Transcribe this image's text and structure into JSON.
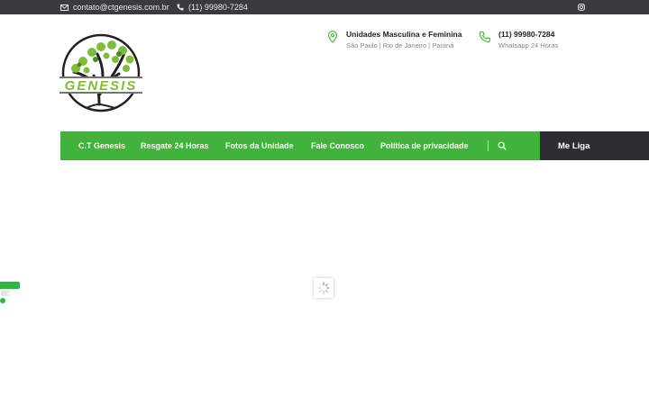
{
  "topbar": {
    "email": "contato@ctgenesis.com.br",
    "phone": "(11) 99980-7284",
    "social_icon": "instagram-icon"
  },
  "brand": {
    "logo_text": "GENESIS",
    "colors": {
      "green": "#3fb33a",
      "dark": "#2d2d33"
    }
  },
  "header_info": {
    "units_title": "Unidades Masculina e Feminina",
    "units_sub": "São Paulo | Rio de Janeiro | Paraná",
    "phone_title": "(11) 99980-7284",
    "phone_sub": "Whatsapp 24 Horas"
  },
  "nav": {
    "items": [
      {
        "label": "C.T Genesis"
      },
      {
        "label": "Resgate 24 Horas"
      },
      {
        "label": "Fotos da Unidade"
      },
      {
        "label": "Fale Conosco"
      },
      {
        "label": "Política de privacidade"
      }
    ],
    "cta_label": "Me Liga"
  }
}
